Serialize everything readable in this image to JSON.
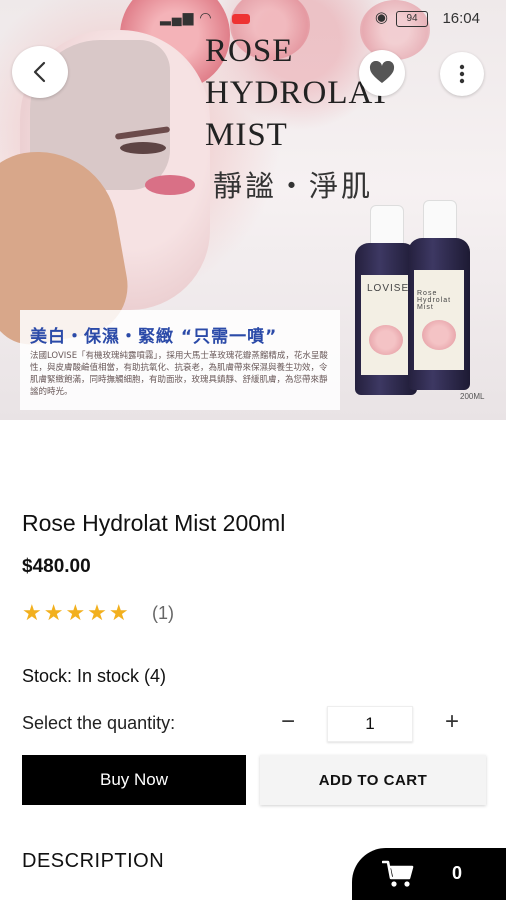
{
  "status_bar": {
    "time": "16:04",
    "battery": "94"
  },
  "poster": {
    "title_line1": "ROSE",
    "title_line2": "HYDROLAT",
    "title_line3": "MIST",
    "subtitle_cjk": "靜謐・淨肌",
    "tagline": "美白・保濕・緊緻 “只需一噴”",
    "body_text": "法國LOVISE「有機玫瑰純露噴霧」，採用大馬士革玫瑰花瓣蒸餾精成，花水呈酸性，與皮膚酸鹼值相當，有助抗氧化、抗衰老，為肌膚帶來保濕與養生功效，令肌膚緊緻飽滿，同時撫觸細胞，有助面妝，玫瑰具鎮靜、舒緩肌膚，為您帶來靜謐的時光。",
    "brand": "LOVISE",
    "bottle_label": "Rose Hydrolat Mist",
    "size": "200ML"
  },
  "product": {
    "title": "Rose Hydrolat Mist 200ml",
    "price": "$480.00",
    "rating": 5,
    "stars": "★★★★★",
    "review_count": "(1)",
    "stock": "Stock: In stock (4)"
  },
  "quantity": {
    "label": "Select the quantity:",
    "minus": "−",
    "value": "1",
    "plus": "+"
  },
  "actions": {
    "buy_now": "Buy Now",
    "add_to_cart": "ADD TO CART"
  },
  "description_heading": "DESCRIPTION",
  "cart": {
    "count": "0"
  },
  "colors": {
    "accent": "#000000",
    "star": "#f2b01e"
  }
}
